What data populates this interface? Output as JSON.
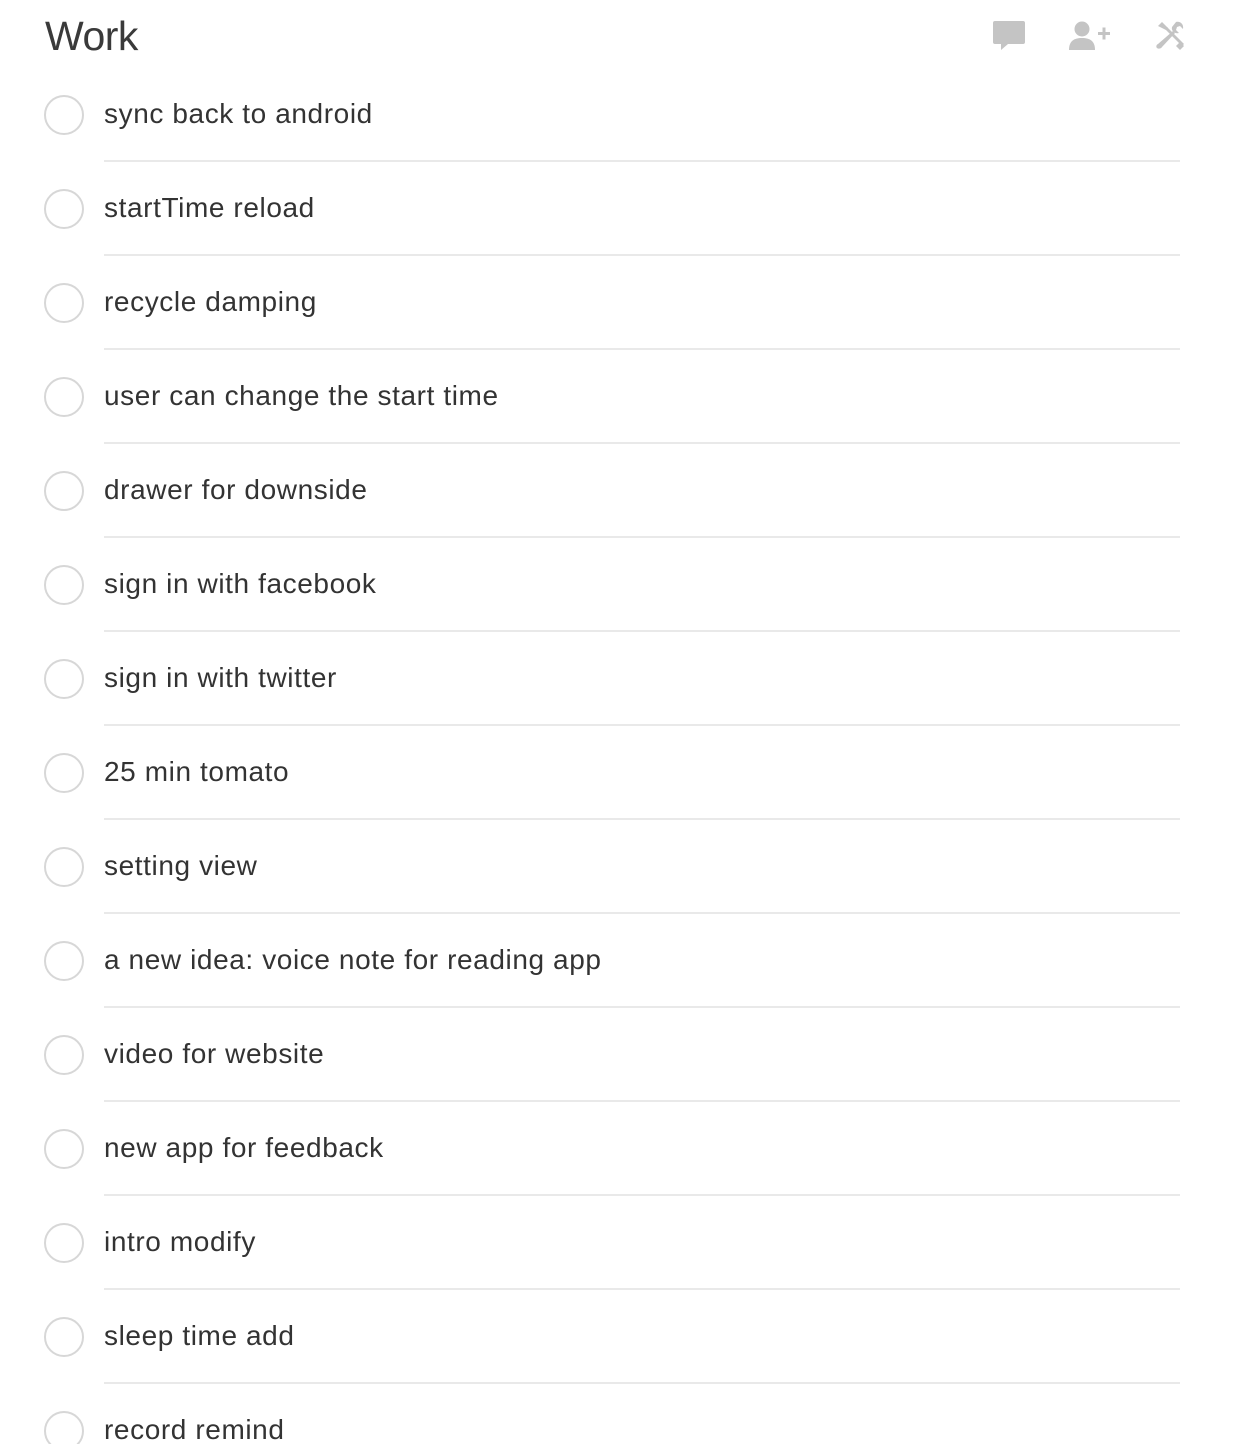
{
  "list": {
    "title": "Work"
  },
  "toolbar": {
    "comments_icon": "comment-bubble-icon",
    "share_icon": "add-person-icon",
    "settings_icon": "tools-icon",
    "icon_color": "#c4c4c4"
  },
  "tasks": [
    {
      "label": "sync back to android",
      "completed": false
    },
    {
      "label": "startTime reload",
      "completed": false
    },
    {
      "label": "recycle damping",
      "completed": false
    },
    {
      "label": "user can change the start time",
      "completed": false
    },
    {
      "label": "drawer for downside",
      "completed": false
    },
    {
      "label": "sign in with facebook",
      "completed": false
    },
    {
      "label": "sign in with twitter",
      "completed": false
    },
    {
      "label": "25 min tomato",
      "completed": false
    },
    {
      "label": "setting view",
      "completed": false
    },
    {
      "label": "a new idea: voice note for reading app",
      "completed": false
    },
    {
      "label": "video for website",
      "completed": false
    },
    {
      "label": "new app for feedback",
      "completed": false
    },
    {
      "label": "intro modify",
      "completed": false
    },
    {
      "label": "sleep time add",
      "completed": false
    },
    {
      "label": "record remind",
      "completed": false
    }
  ]
}
